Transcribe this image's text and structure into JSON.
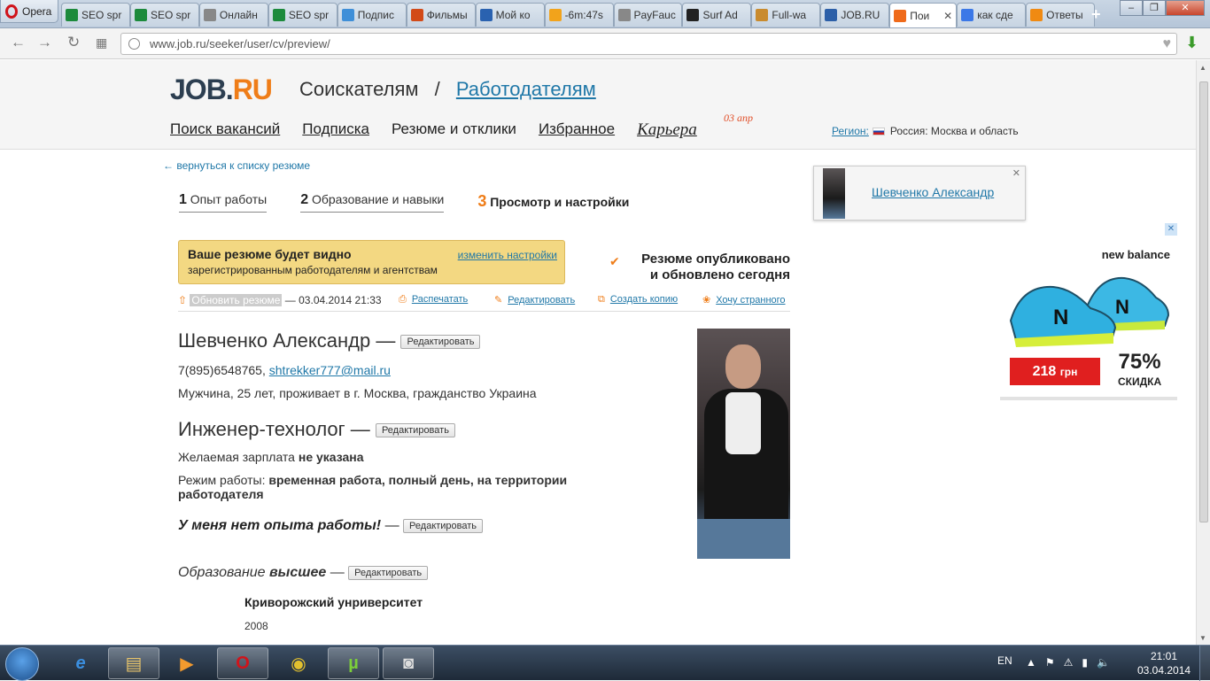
{
  "browser": {
    "menu_label": "Opera",
    "tabs": [
      {
        "title": "SEO spr",
        "icon": "dollar-icon",
        "color": "#1c8a3c"
      },
      {
        "title": "SEO spr",
        "icon": "dollar-icon",
        "color": "#1c8a3c"
      },
      {
        "title": "Онлайн",
        "icon": "page-icon",
        "color": "#888888"
      },
      {
        "title": "SEO spr",
        "icon": "dollar-icon",
        "color": "#1c8a3c"
      },
      {
        "title": "Подпис",
        "icon": "heart-icon",
        "color": "#3f8fd8"
      },
      {
        "title": "Фильмы",
        "icon": "ki-icon",
        "color": "#d24a18"
      },
      {
        "title": "Мой ко",
        "icon": "box-icon",
        "color": "#2a62b0"
      },
      {
        "title": "-6m:47s",
        "icon": "bitcoin-icon",
        "color": "#f2a31b"
      },
      {
        "title": "PayFauc",
        "icon": "page-icon",
        "color": "#888888"
      },
      {
        "title": "Surf Ad",
        "icon": "bc-icon",
        "color": "#222222"
      },
      {
        "title": "Full-wa",
        "icon": "bag-icon",
        "color": "#c98b2e"
      },
      {
        "title": "JOB.RU",
        "icon": "globe-icon",
        "color": "#2c5fa8"
      },
      {
        "title": "Пои",
        "icon": "j-icon",
        "color": "#ef6a1a",
        "active": true
      },
      {
        "title": "как сде",
        "icon": "google-icon",
        "color": "#3b78e7"
      },
      {
        "title": "Ответы",
        "icon": "question-icon",
        "color": "#f08a12"
      }
    ],
    "url": "www.job.ru/seeker/user/cv/preview/"
  },
  "header": {
    "logo_main": "JOB.",
    "logo_accent": "RU",
    "seekers": "Соискателям",
    "separator": "/",
    "employers": "Работодателям",
    "nav": {
      "search": "Поиск вакансий",
      "subscription": "Подписка",
      "resumes": "Резюме и отклики",
      "favorites": "Избранное",
      "career": "Карьера",
      "career_badge": "03 апр"
    },
    "region_label": "Регион:",
    "region_value": "Россия: Москва и область"
  },
  "page": {
    "back_link": "← вернуться к списку резюме",
    "steps": [
      {
        "num": "1",
        "label": "Опыт работы"
      },
      {
        "num": "2",
        "label": "Образование и навыки"
      },
      {
        "num": "3",
        "label": "Просмотр и настройки"
      }
    ],
    "notice": {
      "title": "Ваше резюме будет видно",
      "text": "зарегистрированным работодателям и агентствам",
      "change": "изменить настройки"
    },
    "published_line1": "Резюме опубликовано",
    "published_line2": "и обновлено сегодня",
    "actions": {
      "update": "Обновить резюме",
      "updated_at": "— 03.04.2014 21:33",
      "print": "Распечатать",
      "edit": "Редактировать",
      "copy": "Создать копию",
      "weird": "Хочу странного"
    },
    "edit_button": "Редактировать",
    "name": "Шевченко Александр —",
    "phone": "7(895)6548765,",
    "email": "shtrekker777@mail.ru",
    "bio": "Мужчина, 25 лет, проживает в г. Москва, гражданство Украина",
    "position": "Инженер-технолог —",
    "salary_label": "Желаемая зарплата",
    "salary_value": "не указана",
    "mode_label": "Режим работы:",
    "mode_value": "временная работа, полный день, на территории работодателя",
    "no_experience": "У меня нет опыта работы!",
    "dash": "—",
    "education_label": "Образование",
    "education_value": "высшее",
    "university": "Криворожский унриверситет",
    "year": "2008"
  },
  "sidebar": {
    "name_card": "Шевченко Александр"
  },
  "ad": {
    "brand": "new balance",
    "price": "218",
    "currency": "грн",
    "discount": "75%",
    "discount_label": "СКИДКА"
  },
  "taskbar": {
    "lang": "EN",
    "time": "21:01",
    "date": "03.04.2014"
  },
  "colors": {
    "accent": "#ef7d18",
    "link": "#2078a8",
    "notice": "#f3d882"
  }
}
